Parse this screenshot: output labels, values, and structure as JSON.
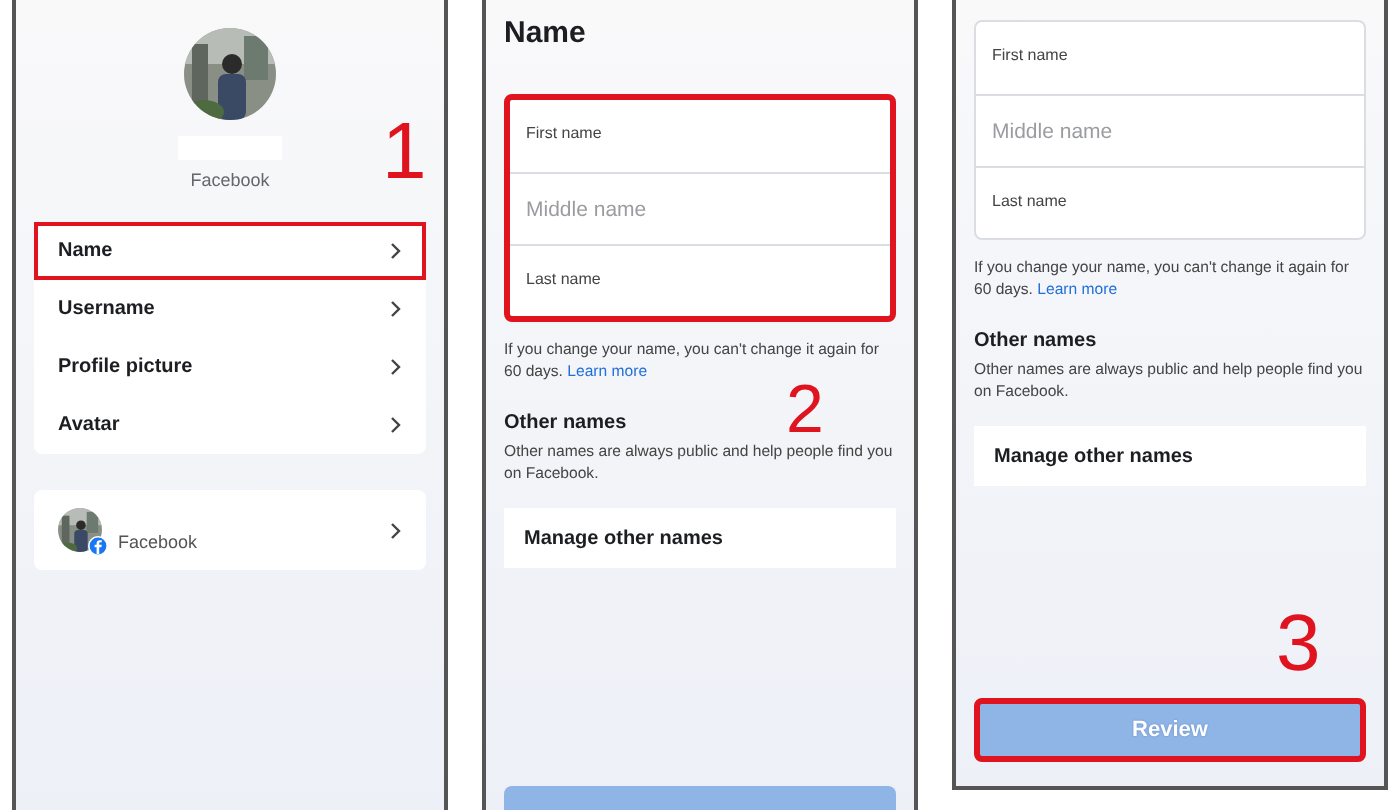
{
  "panels": [
    {
      "kind": "profile",
      "annotation": "1",
      "account_label": "Facebook",
      "menu": [
        {
          "label": "Name",
          "highlighted": true
        },
        {
          "label": "Username",
          "highlighted": false
        },
        {
          "label": "Profile picture",
          "highlighted": false
        },
        {
          "label": "Avatar",
          "highlighted": false
        }
      ],
      "linked_account": {
        "label": "Facebook"
      }
    },
    {
      "kind": "name_form",
      "title": "Name",
      "annotation": "2",
      "fields_highlighted": true,
      "fields": [
        {
          "kind": "floating",
          "label": "First name"
        },
        {
          "kind": "placeholder",
          "placeholder": "Middle name"
        },
        {
          "kind": "floating",
          "label": "Last name"
        }
      ],
      "helper": "If you change your name, you can't change it again for 60 days.",
      "link": "Learn more",
      "other_title": "Other names",
      "other_text": "Other names are always public and help people find you on Facebook.",
      "manage": "Manage other names",
      "submit": {
        "highlighted": false
      }
    },
    {
      "kind": "name_form",
      "annotation": "3",
      "fields_highlighted": false,
      "fields": [
        {
          "kind": "floating",
          "label": "First name"
        },
        {
          "kind": "placeholder",
          "placeholder": "Middle name"
        },
        {
          "kind": "floating",
          "label": "Last name"
        }
      ],
      "helper": "If you change your name, you can't change it again for 60 days.",
      "link": "Learn more",
      "other_title": "Other names",
      "other_text": "Other names are always public and help people find you on Facebook.",
      "manage": "Manage other names",
      "submit": {
        "label": "Review",
        "highlighted": true
      }
    }
  ]
}
